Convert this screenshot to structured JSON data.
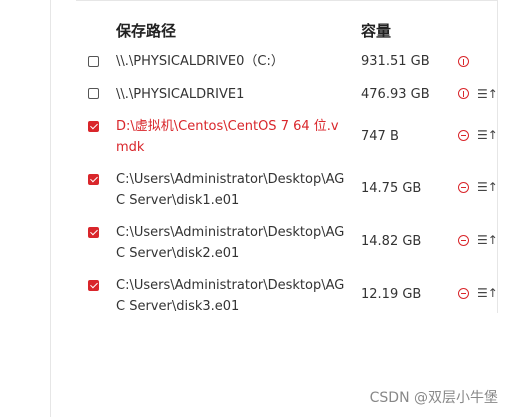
{
  "table": {
    "header": {
      "path": "保存路径",
      "size": "容量"
    },
    "rows": [
      {
        "path": "\\\\.\\PHYSICALDRIVE0（C:）",
        "size": "931.51 GB",
        "checked": false,
        "status_icon": "info-icon",
        "has_sort": false
      },
      {
        "path": "\\\\.\\PHYSICALDRIVE1",
        "size": "476.93 GB",
        "checked": false,
        "status_icon": "info-icon",
        "has_sort": true
      },
      {
        "path": "D:\\虚拟机\\Centos\\CentOS 7 64 位.vmdk",
        "size": "747 B",
        "checked": true,
        "status_icon": "remove-icon",
        "has_sort": true
      },
      {
        "path": "C:\\Users\\Administrator\\Desktop\\AGC Server\\disk1.e01",
        "size": "14.75 GB",
        "checked": true,
        "status_icon": "remove-icon",
        "has_sort": true
      },
      {
        "path": "C:\\Users\\Administrator\\Desktop\\AGC Server\\disk2.e01",
        "size": "14.82 GB",
        "checked": true,
        "status_icon": "remove-icon",
        "has_sort": true
      },
      {
        "path": "C:\\Users\\Administrator\\Desktop\\AGC Server\\disk3.e01",
        "size": "12.19 GB",
        "checked": true,
        "status_icon": "remove-icon",
        "has_sort": true
      }
    ],
    "sort_glyph": "☰↑"
  },
  "watermark": "CSDN @双层小牛堡",
  "colors": {
    "accent": "#d9262b",
    "text": "#333333",
    "divider": "#e6e6e6"
  }
}
